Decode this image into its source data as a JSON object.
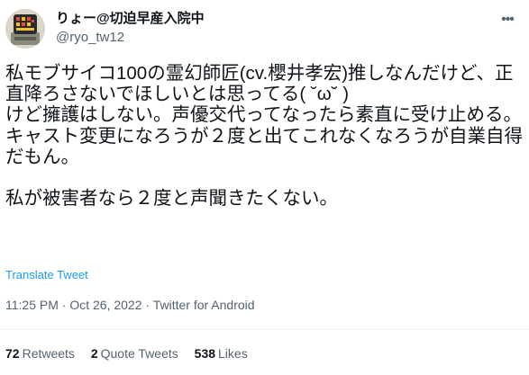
{
  "author": {
    "display_name": "りょー@切迫早産入院中",
    "handle": "@ryo_tw12"
  },
  "more_icon": "more-horizontal-icon",
  "tweet": {
    "text": "私モブサイコ100の霊幻師匠(cv.櫻井孝宏)推しなんだけど、正直降ろさないでほしいとは思ってる( ˘ω˘ )\nけど擁護はしない。声優交代ってなったら素直に受け止める。\nキャスト変更になろうが２度と出てこれなくなろうが自業自得だもん。\n\n私が被害者なら２度と声聞きたくない。",
    "translate_label": "Translate Tweet"
  },
  "meta": {
    "time": "11:25 PM",
    "separator": "·",
    "date": "Oct 26, 2022",
    "source": "Twitter for Android"
  },
  "stats": {
    "retweets_count": "72",
    "retweets_label": "Retweets",
    "quotes_count": "2",
    "quotes_label": "Quote Tweets",
    "likes_count": "538",
    "likes_label": "Likes"
  }
}
